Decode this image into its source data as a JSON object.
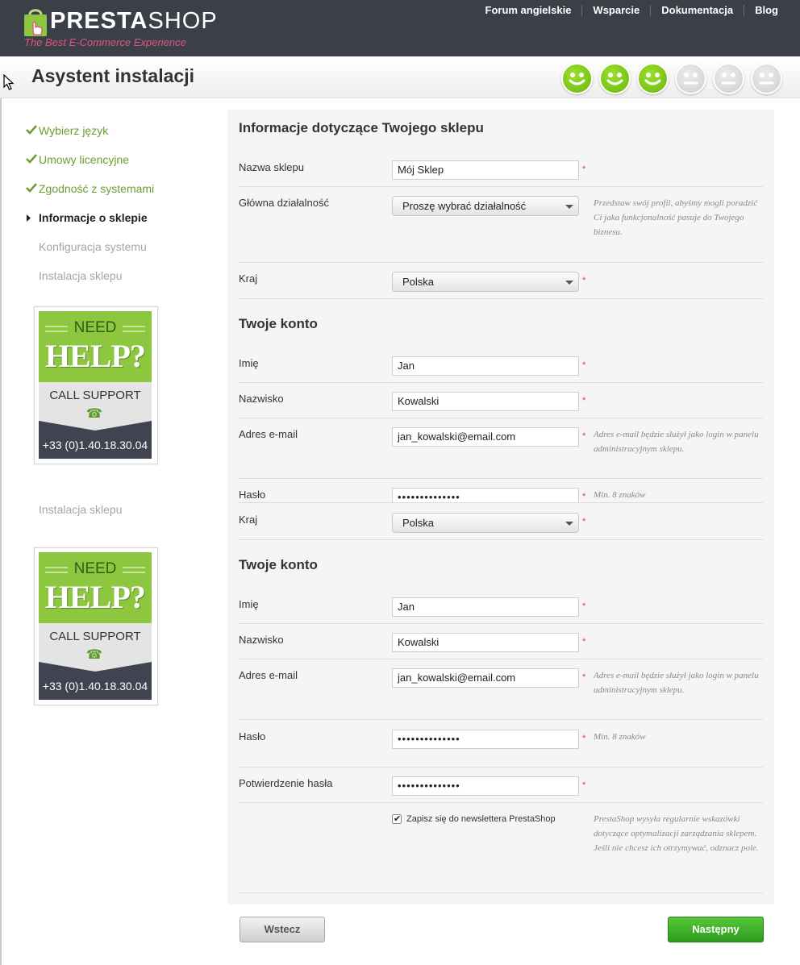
{
  "header": {
    "logo": {
      "brand_a": "PRESTA",
      "brand_b": "SHOP",
      "tagline": "The Best E-Commerce Experience"
    },
    "links": [
      "Forum angielskie",
      "Wsparcie",
      "Dokumentacja",
      "Blog"
    ]
  },
  "title": "Asystent instalacji",
  "progress": {
    "total": 6,
    "completed": 3
  },
  "sidebar": {
    "steps": [
      {
        "label": "Wybierz język",
        "state": "done"
      },
      {
        "label": "Umowy licencyjne",
        "state": "done"
      },
      {
        "label": "Zgodność z systemami",
        "state": "done"
      },
      {
        "label": "Informacje o sklepie",
        "state": "current"
      },
      {
        "label": "Konfiguracja systemu",
        "state": "future"
      },
      {
        "label": "Instalacja sklepu",
        "state": "future"
      }
    ],
    "extra_label": "Instalacja sklepu",
    "help": {
      "need": "NEED",
      "help": "HELP?",
      "call": "CALL SUPPORT",
      "phone": "+33 (0)1.40.18.30.04"
    }
  },
  "form": {
    "shop_section": "Informacje dotyczące Twojego sklepu",
    "shop_name_label": "Nazwa sklepu",
    "shop_name_value": "Mój Sklep",
    "activity_label": "Główna działalność",
    "activity_value": "Proszę wybrać działalność",
    "activity_hint": "Przedstaw swój profil, abyśmy mogli poradzić Ci jaka funkcjonalność pasuje do Twojego biznesu.",
    "country_label": "Kraj",
    "country_value": "Polska",
    "account_section": "Twoje konto",
    "first_name_label": "Imię",
    "first_name_value": "Jan",
    "last_name_label": "Nazwisko",
    "last_name_value": "Kowalski",
    "email_label": "Adres e-mail",
    "email_value": "jan_kowalski@email.com",
    "email_hint": "Adres e-mail będzie służył jako login w panelu administracyjnym sklepu.",
    "password_label": "Hasło",
    "password_value": "••••••••••••••",
    "password_hint": "Min. 8 znaków",
    "confirm_label": "Potwierdzenie hasła",
    "confirm_value": "••••••••••••••",
    "newsletter_label": "Zapisz się do newslettera PrestaShop",
    "newsletter_checked": true,
    "newsletter_hint": "PrestaShop wysyła regularnie wskazówki dotyczące optymalizacji zarządzania sklepem. Jeśli nie chcesz ich otrzymywać, odznacz pole.",
    "required_mark": "*"
  },
  "buttons": {
    "back": "Wstecz",
    "next": "Następny"
  }
}
